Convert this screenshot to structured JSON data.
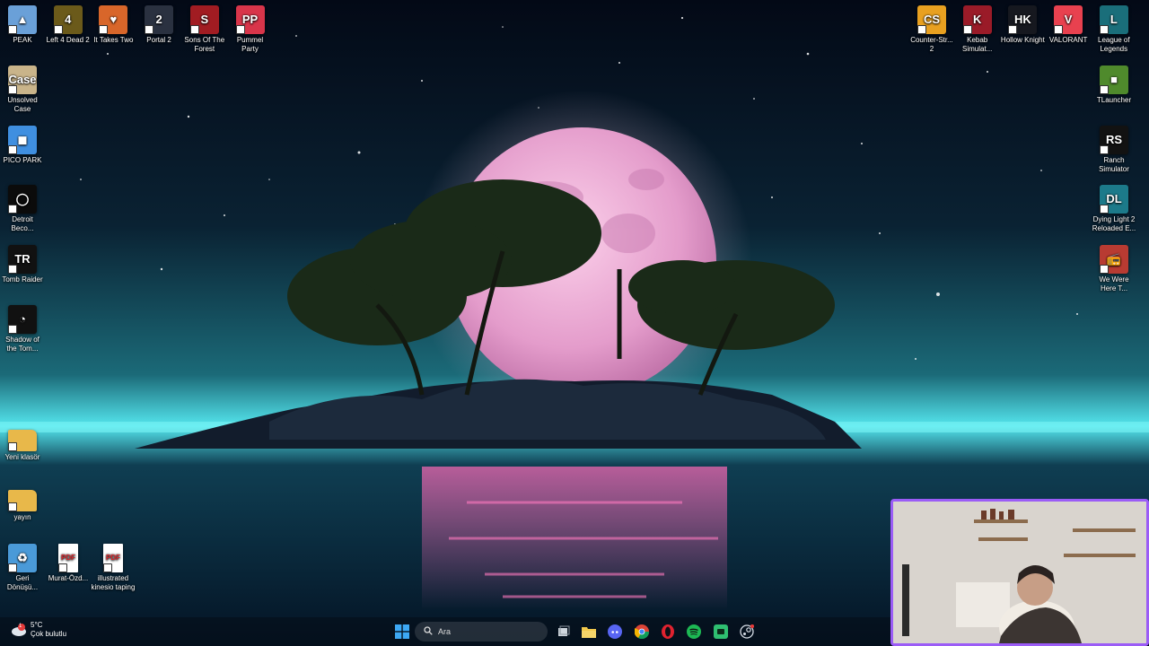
{
  "desktop": {
    "icons_top": [
      {
        "label": "PEAK",
        "name": "icon-peak",
        "glyph": "▲",
        "color": "#6aa0d8"
      },
      {
        "label": "Left 4 Dead 2",
        "name": "icon-left4dead2",
        "glyph": "4",
        "color": "#6b5a1a"
      },
      {
        "label": "It Takes Two",
        "name": "icon-ittakestwo",
        "glyph": "♥",
        "color": "#d8662a"
      },
      {
        "label": "Portal 2",
        "name": "icon-portal2",
        "glyph": "2",
        "color": "#2a3140"
      },
      {
        "label": "Sons Of The Forest",
        "name": "icon-sonsoftheforest",
        "glyph": "S",
        "color": "#a11c22"
      },
      {
        "label": "Pummel Party",
        "name": "icon-pummelparty",
        "glyph": "PP",
        "color": "#d8354a"
      }
    ],
    "icons_left": [
      {
        "label": "Unsolved Case",
        "name": "icon-unsolvedcase",
        "glyph": "Case",
        "color": "#c9b48a"
      },
      {
        "label": "PICO PARK",
        "name": "icon-picopark",
        "glyph": "◼",
        "color": "#3f8fe0"
      },
      {
        "label": "Detroit Beco...",
        "name": "icon-detroit",
        "glyph": "◯",
        "color": "#0b0b0b"
      },
      {
        "label": "Tomb Raider",
        "name": "icon-tombraider",
        "glyph": "TR",
        "color": "#111111"
      },
      {
        "label": "Shadow of the Tom...",
        "name": "icon-shadowtombraider",
        "glyph": "◔",
        "color": "#111111"
      },
      {
        "label": "Yeni klasör",
        "name": "icon-folder-yeni",
        "glyph": "",
        "color": "#e8b84a"
      },
      {
        "label": "yayın",
        "name": "icon-folder-yayin",
        "glyph": "",
        "color": "#e8b84a"
      },
      {
        "label": "Geri Dönüşü...",
        "name": "icon-recyclebin",
        "glyph": "♻",
        "color": "#4a9ad8"
      }
    ],
    "icons_bottom": [
      {
        "label": "Murat-Özd...",
        "name": "icon-pdf-murat",
        "glyph": "PDF",
        "color": "#d9262c"
      },
      {
        "label": "illustrated kinesio taping",
        "name": "icon-pdf-kinesio",
        "glyph": "PDF",
        "color": "#d9262c"
      }
    ],
    "icons_right_top": [
      {
        "label": "Counter-Str... 2",
        "name": "icon-counterstrike2",
        "glyph": "CS",
        "color": "#e8a020"
      },
      {
        "label": "Kebab Simulat...",
        "name": "icon-kebabsimulator",
        "glyph": "K",
        "color": "#9a1b28"
      },
      {
        "label": "Hollow Knight",
        "name": "icon-hollowknight",
        "glyph": "HK",
        "color": "#16181f"
      },
      {
        "label": "VALORANT",
        "name": "icon-valorant",
        "glyph": "V",
        "color": "#e8414f"
      },
      {
        "label": "League of Legends",
        "name": "icon-leagueoflegends",
        "glyph": "L",
        "color": "#1a6e7a"
      }
    ],
    "icons_right": [
      {
        "label": "TLauncher",
        "name": "icon-tlauncher",
        "glyph": "■",
        "color": "#4f8a2c"
      },
      {
        "label": "Ranch Simulator",
        "name": "icon-ranchsimulator",
        "glyph": "RS",
        "color": "#121212"
      },
      {
        "label": "Dying Light 2 Reloaded E...",
        "name": "icon-dyinglight2",
        "glyph": "DL",
        "color": "#1c7a8a"
      },
      {
        "label": "We Were Here T...",
        "name": "icon-wewerehere",
        "glyph": "📻",
        "color": "#b83b32"
      }
    ]
  },
  "taskbar": {
    "weather": {
      "temp": "5°C",
      "condition": "Çok bulutlu",
      "badge": "1"
    },
    "search_placeholder": "Ara",
    "apps": [
      {
        "name": "task-view-icon"
      },
      {
        "name": "file-explorer-icon"
      },
      {
        "name": "discord-icon"
      },
      {
        "name": "chrome-icon"
      },
      {
        "name": "opera-gx-icon"
      },
      {
        "name": "spotify-icon"
      },
      {
        "name": "app-green-icon"
      },
      {
        "name": "steam-icon"
      }
    ]
  },
  "colors": {
    "accent_frame": "#9b5cf6",
    "moon": "#f0b4d8",
    "sea_glow": "#35e6e8"
  }
}
